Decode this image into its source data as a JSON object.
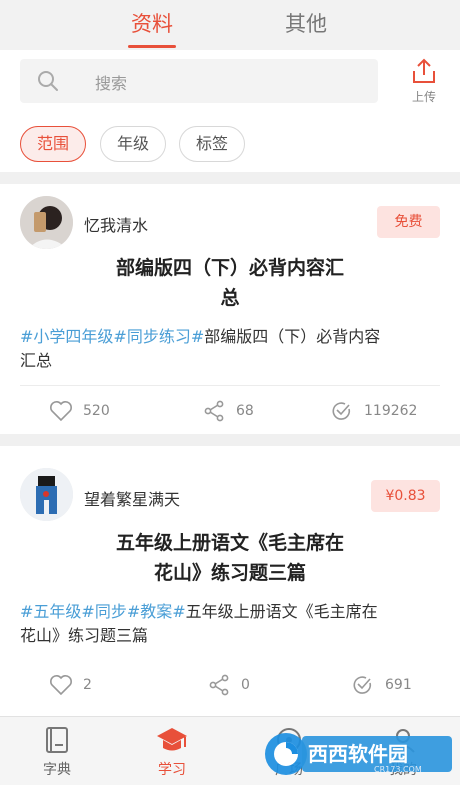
{
  "top_tabs": [
    {
      "label": "资料",
      "active": true
    },
    {
      "label": "其他",
      "active": false
    }
  ],
  "search": {
    "placeholder": "搜索"
  },
  "upload": {
    "label": "上传"
  },
  "filters": [
    {
      "label": "范围",
      "active": true
    },
    {
      "label": "年级",
      "active": false
    },
    {
      "label": "标签",
      "active": false
    }
  ],
  "cards": [
    {
      "author": "忆我清水",
      "price": "免费",
      "title_line1": "部编版四（下）必背内容汇",
      "title_line2": "总",
      "tags": [
        "#小学四年级",
        "#同步练习#"
      ],
      "desc_line1": "部编版四（下）必背内容",
      "desc_line2": "汇总",
      "likes": "520",
      "shares": "68",
      "views": "119262"
    },
    {
      "author": "望着繁星满天",
      "price": "¥0.83",
      "title_line1": "五年级上册语文《毛主席在",
      "title_line2": "花山》练习题三篇",
      "tags": [
        "#五年级",
        "#同步",
        "#教案#"
      ],
      "desc_line1": "五年级上册语文《毛主席在",
      "desc_line2": "花山》练习题三篇",
      "likes": "2",
      "shares": "0",
      "views": "691"
    }
  ],
  "bottom_nav": [
    {
      "label": "字典",
      "icon": "book-icon",
      "active": false
    },
    {
      "label": "学习",
      "icon": "graduation-cap-icon",
      "active": true
    },
    {
      "label": "广场",
      "icon": "plaza-icon",
      "active": false
    },
    {
      "label": "我的",
      "icon": "profile-icon",
      "active": false
    }
  ],
  "watermark": {
    "text": "西西软件园",
    "subtext": "CR173.COM"
  },
  "colors": {
    "accent": "#e8503a",
    "tag": "#4a9ed6",
    "badge_bg": "#fde3e0"
  }
}
